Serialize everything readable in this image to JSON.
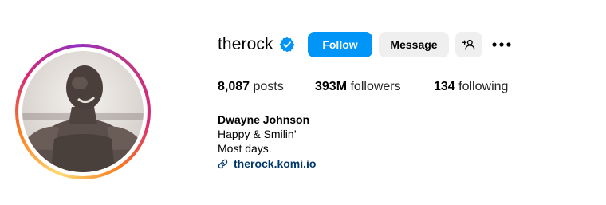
{
  "profile": {
    "username": "therock",
    "verified": true,
    "avatar_alt": "profile-photo",
    "actions": {
      "follow_label": "Follow",
      "message_label": "Message",
      "suggest_icon": "person-add-icon",
      "more_icon": "more-options-icon"
    },
    "stats": {
      "posts": {
        "count": "8,087",
        "label": "posts"
      },
      "followers": {
        "count": "393M",
        "label": "followers"
      },
      "following": {
        "count": "134",
        "label": "following"
      }
    },
    "bio": {
      "full_name": "Dwayne Johnson",
      "lines": [
        "Happy & Smilin’",
        "Most days."
      ],
      "link": "therock.komi.io",
      "link_icon": "link-icon"
    }
  },
  "colors": {
    "primary_button": "#0095f6",
    "secondary_button": "#efefef",
    "link": "#00376b",
    "verified_badge": "#0095f6"
  }
}
